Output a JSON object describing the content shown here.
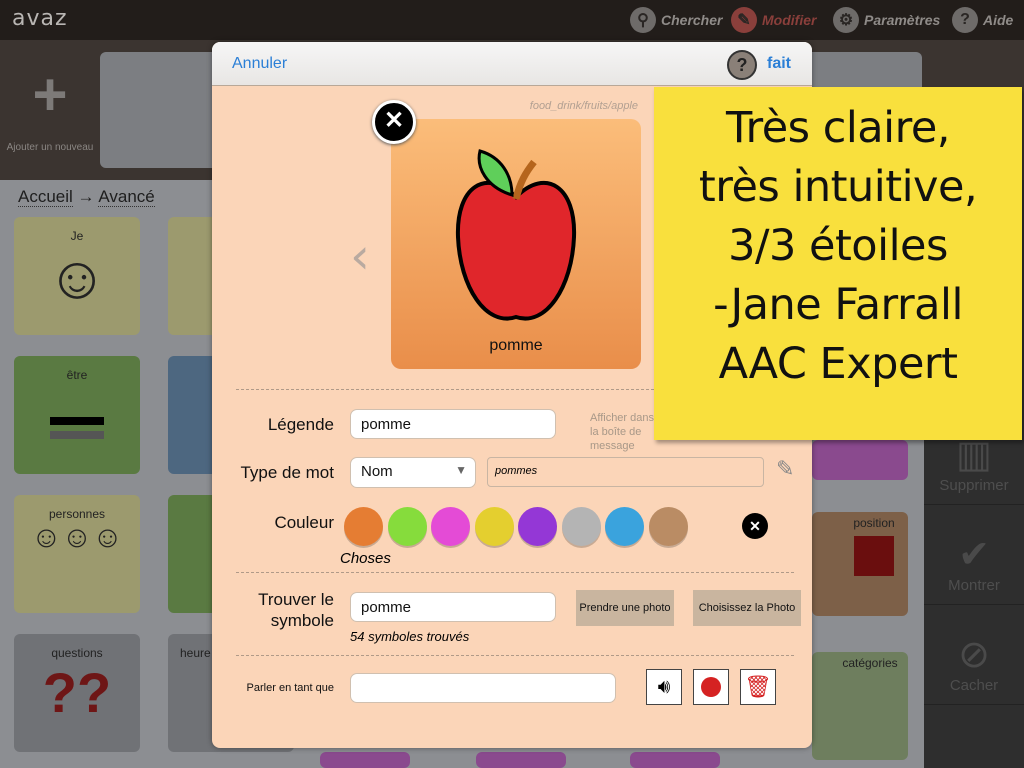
{
  "app": {
    "title": "avaz"
  },
  "toolbar": {
    "search": "Chercher",
    "edit": "Modifier",
    "settings": "Paramètres",
    "help": "Aide"
  },
  "add_new": "Ajouter un nouveau",
  "breadcrumb": {
    "home": "Accueil",
    "arrow": "→",
    "current": "Avancé"
  },
  "tiles": [
    {
      "label": "Je",
      "color": "#9c9a6e"
    },
    {
      "label": "être",
      "color": "#5a7a42"
    },
    {
      "label": "personnes",
      "color": "#9c9a6e"
    },
    {
      "label": "questions",
      "color": "#707276"
    },
    {
      "label": "heure",
      "color": "#707276"
    },
    {
      "label": "position",
      "color": "#7d6048"
    },
    {
      "label": "catégories",
      "color": "#6e7e5e"
    }
  ],
  "right_panel": {
    "delete": "Supprimer",
    "show": "Montrer",
    "hide": "Cacher"
  },
  "modal": {
    "cancel": "Annuler",
    "done": "fait",
    "help_icon": "?",
    "symbol_path": "food_drink/fruits/apple",
    "card_caption": "pomme",
    "caption_label": "Légende",
    "caption_value": "pomme",
    "show_in_message_hint": "Afficher dans la boîte de message",
    "word_type_label": "Type de mot",
    "word_type_value": "Nom",
    "plural_value": "pommes",
    "color_label": "Couleur",
    "color_category": "Choses",
    "colors": [
      "#e57d33",
      "#86dc3c",
      "#e44bd6",
      "#e4cf2f",
      "#9437d6",
      "#b4b4b4",
      "#3aa3dd",
      "#ba8c64"
    ],
    "find_symbol_label": "Trouver le symbole",
    "find_symbol_value": "pomme",
    "symbols_found": "54 symboles trouvés",
    "take_photo": "Prendre une photo",
    "choose_photo": "Choisissez la Photo",
    "speak_as_label": "Parler en tant que",
    "speak_as_value": ""
  },
  "note": {
    "lines": [
      "Très claire,",
      "très intuitive,",
      "3/3 étoiles",
      "-Jane Farrall",
      "AAC Expert"
    ]
  }
}
